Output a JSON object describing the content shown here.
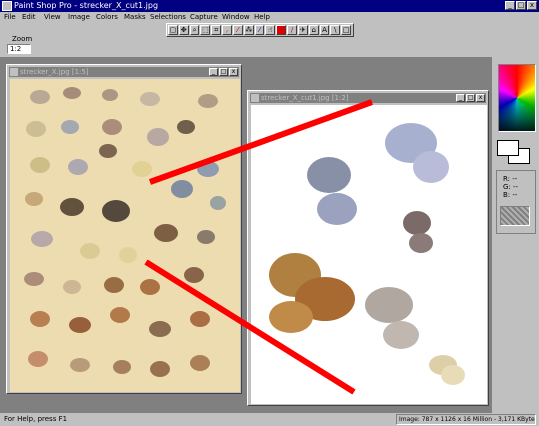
{
  "app": {
    "title": "Paint Shop Pro - strecker_X_cut1.jpg",
    "menu": [
      "File",
      "Edit",
      "View",
      "Image",
      "Colors",
      "Masks",
      "Selections",
      "Capture",
      "Window",
      "Help"
    ]
  },
  "zoom": {
    "label": "Zoom",
    "value": "1:2"
  },
  "tools": [
    "select",
    "move",
    "zoom",
    "deformation",
    "crop",
    "dropper",
    "paintbrush",
    "clone",
    "color-replacer",
    "retouch",
    "eraser",
    "picture-tube",
    "airbrush",
    "flood-fill",
    "text",
    "line",
    "shape"
  ],
  "windows": [
    {
      "title": "strecker_X.jpg [1:5]",
      "controls": [
        "_",
        "□",
        "x"
      ]
    },
    {
      "title": "strecker_X_cut1.jpg [1:2]",
      "controls": [
        "_",
        "□",
        "x"
      ]
    }
  ],
  "color_panel": {
    "rgb_labels": [
      "R: --",
      "G: --",
      "B: --"
    ]
  },
  "status": {
    "help": "For Help, press F1",
    "image_info": "Image: 787 x 1126 x 16 Million - 3,171 KBytes"
  },
  "accent": {
    "titlebar": "#000080",
    "annotation": "#ff0000",
    "inactive_caption": "#808080"
  }
}
